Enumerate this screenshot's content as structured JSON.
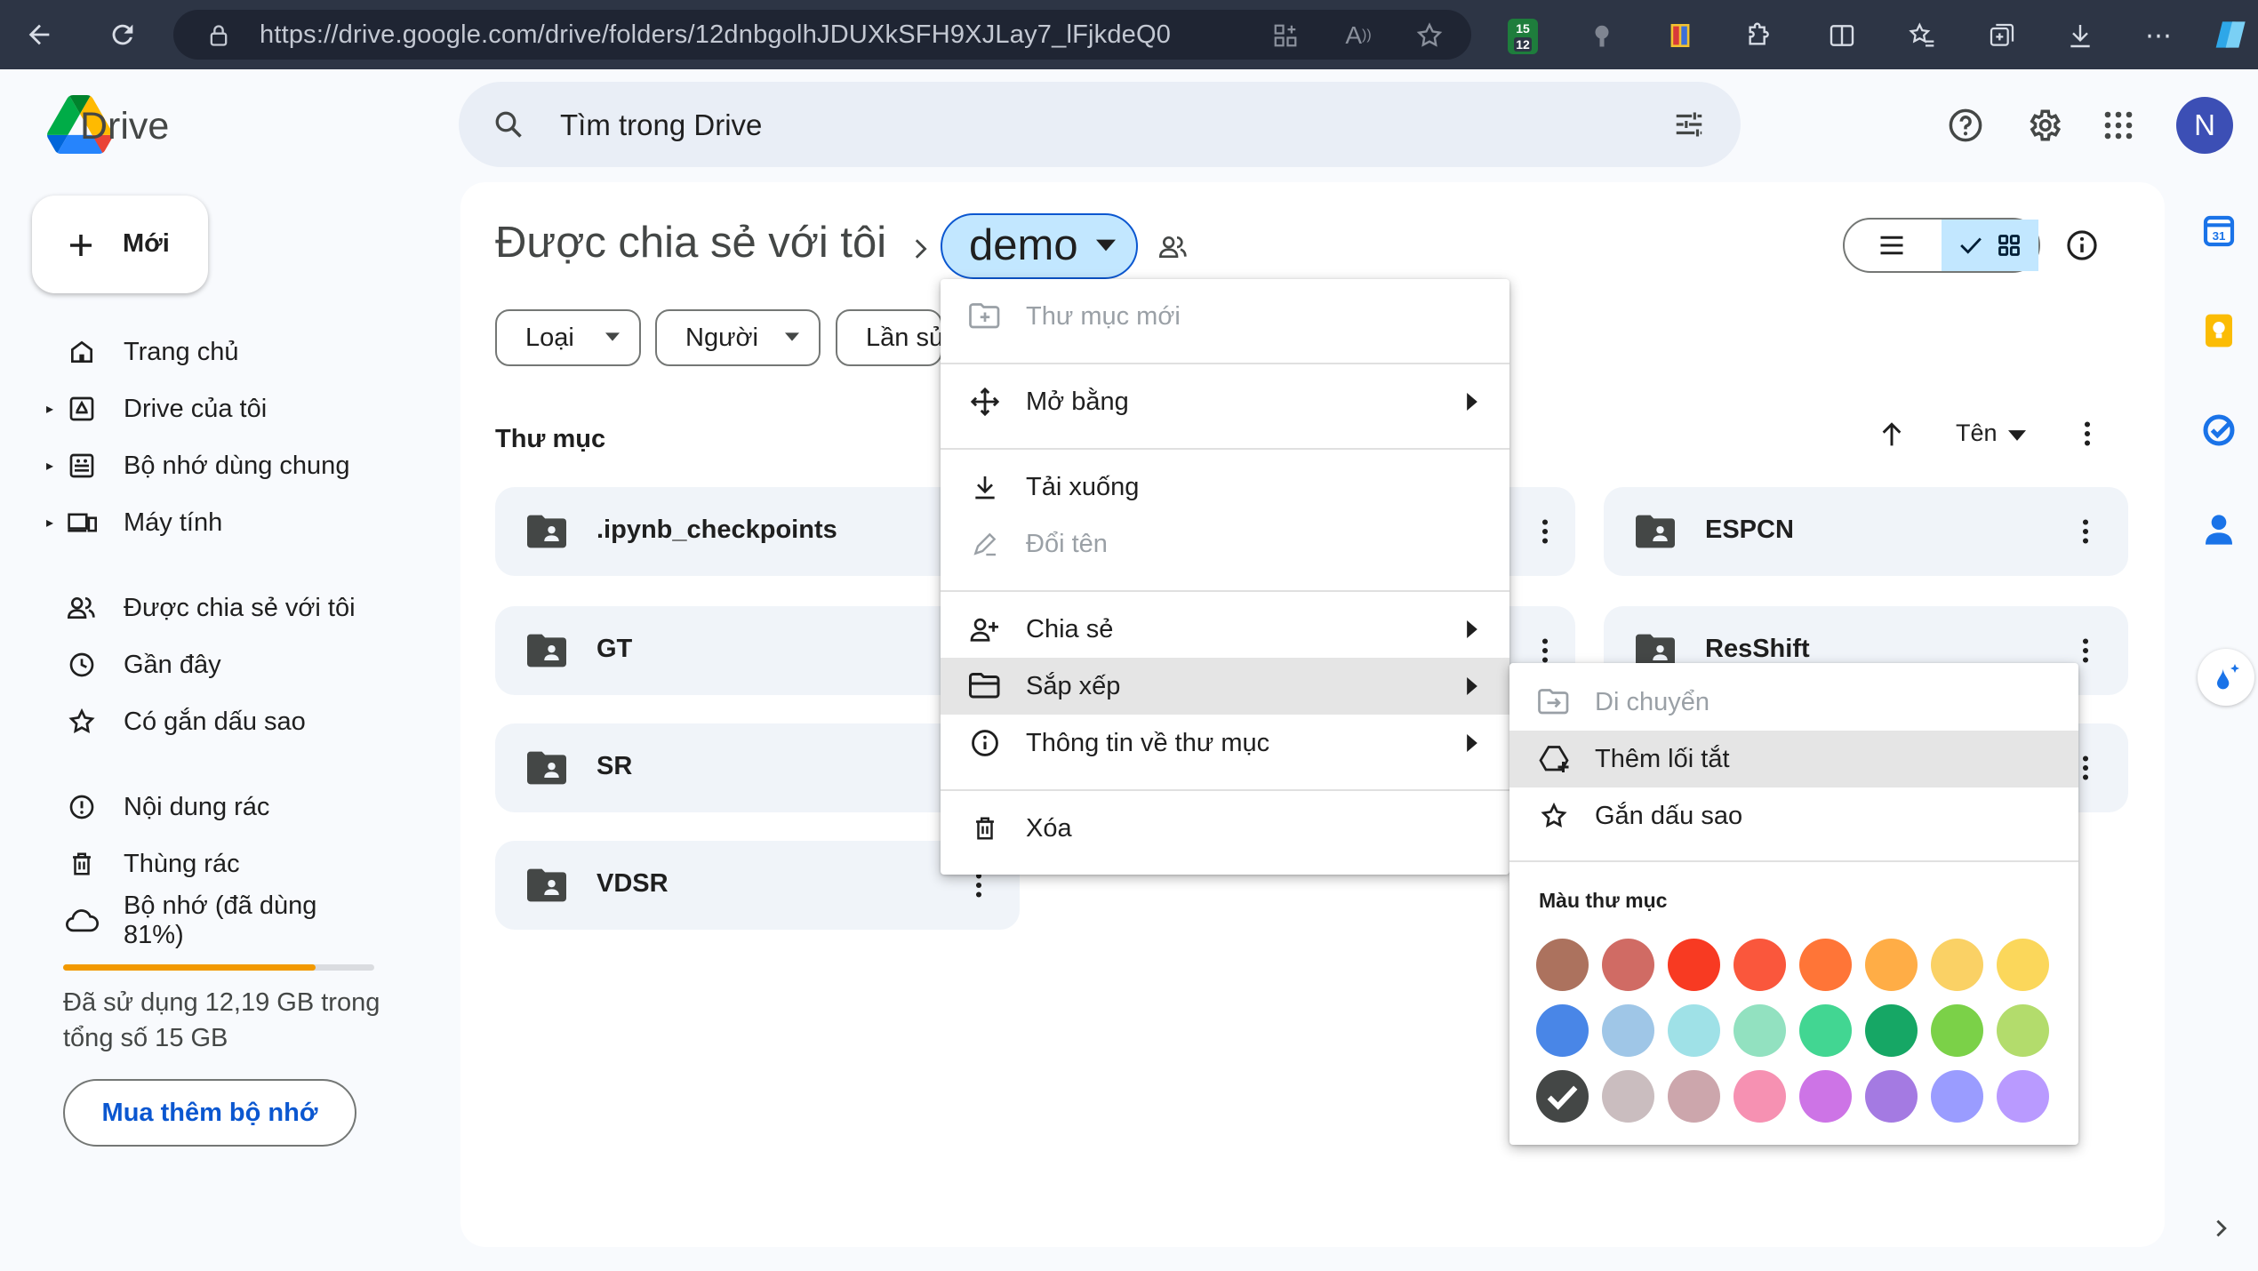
{
  "browser": {
    "url": "https://drive.google.com/drive/folders/12dnbgolhJDUXkSFH9XJLay7_lFjkdeQ0",
    "extension_badge": "12",
    "extension_top": "15"
  },
  "app": {
    "name": "Drive",
    "search_placeholder": "Tìm trong Drive",
    "avatar_letter": "N",
    "brand_colors": {
      "blue": "#0b57d0",
      "selected": "#c2e7ff"
    }
  },
  "sidebar": {
    "new_label": "Mới",
    "items": [
      {
        "label": "Trang chủ",
        "icon": "home-icon"
      },
      {
        "label": "Drive của tôi",
        "icon": "my-drive-icon"
      },
      {
        "label": "Bộ nhớ dùng chung",
        "icon": "shared-drives-icon"
      },
      {
        "label": "Máy tính",
        "icon": "computer-icon"
      },
      {
        "label": "Được chia sẻ với tôi",
        "icon": "people-icon"
      },
      {
        "label": "Gần đây",
        "icon": "clock-icon"
      },
      {
        "label": "Có gắn dấu sao",
        "icon": "star-icon"
      },
      {
        "label": "Nội dung rác",
        "icon": "spam-icon"
      },
      {
        "label": "Thùng rác",
        "icon": "trash-icon"
      },
      {
        "label": "Bộ nhớ (đã dùng 81%)",
        "icon": "cloud-icon"
      }
    ],
    "storage_used_fraction": 0.81,
    "storage_text": "Đã sử dụng 12,19 GB trong tổng số 15 GB",
    "buy_more": "Mua thêm bộ nhớ"
  },
  "main": {
    "breadcrumb_parent": "Được chia sẻ với tôi",
    "breadcrumb_current": "demo",
    "filters": [
      "Loại",
      "Người",
      "Lần sửa đổi"
    ],
    "section_title": "Thư mục",
    "sort_label": "Tên",
    "folders": [
      ".ipynb_checkpoints",
      "ESPCN",
      "GT",
      "ResShift",
      "SR",
      "VDSR"
    ]
  },
  "context_menu": {
    "items": [
      {
        "label": "Thư mục mới",
        "icon": "new-folder-icon",
        "disabled": true
      },
      {
        "label": "Mở bằng",
        "icon": "open-with-icon",
        "submenu": true
      },
      {
        "label": "Tải xuống",
        "icon": "download-icon"
      },
      {
        "label": "Đổi tên",
        "icon": "rename-icon",
        "disabled": true
      },
      {
        "label": "Chia sẻ",
        "icon": "share-icon",
        "submenu": true
      },
      {
        "label": "Sắp xếp",
        "icon": "organize-icon",
        "submenu": true,
        "highlighted": true
      },
      {
        "label": "Thông tin về thư mục",
        "icon": "info-icon",
        "submenu": true
      },
      {
        "label": "Xóa",
        "icon": "trash-icon"
      }
    ]
  },
  "submenu": {
    "items": [
      {
        "label": "Di chuyển",
        "icon": "move-icon",
        "disabled": true
      },
      {
        "label": "Thêm lối tắt",
        "icon": "add-shortcut-icon",
        "highlighted": true
      },
      {
        "label": "Gắn dấu sao",
        "icon": "star-icon"
      }
    ],
    "color_header": "Màu thư mục",
    "colors": [
      "#ac725e",
      "#d06b64",
      "#f83a22",
      "#fa573c",
      "#ff7537",
      "#ffad46",
      "#fad165",
      "#fbd75b",
      "#4986e7",
      "#9fc6e7",
      "#9fe1e7",
      "#92e1c0",
      "#42d692",
      "#16a765",
      "#7bd148",
      "#b3dc6c",
      "#444746",
      "#cabdbf",
      "#cca6ac",
      "#f691b2",
      "#cd74e6",
      "#a47ae2",
      "#9a9cff",
      "#b99aff"
    ],
    "selected_color_index": 16
  }
}
